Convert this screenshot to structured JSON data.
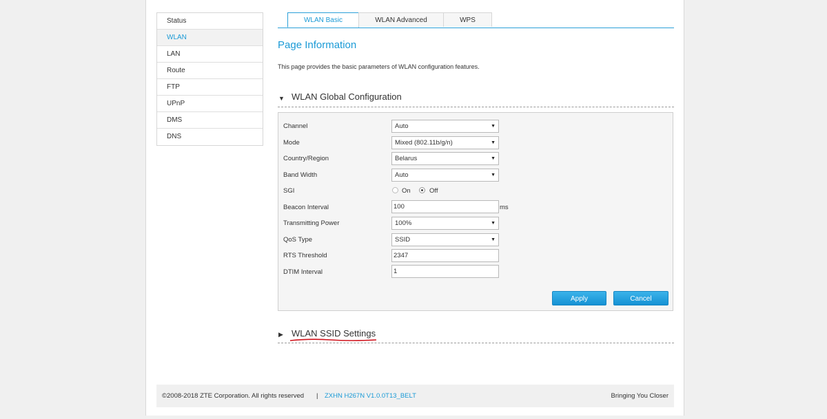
{
  "sidebar": {
    "items": [
      {
        "label": "Status"
      },
      {
        "label": "WLAN"
      },
      {
        "label": "LAN"
      },
      {
        "label": "Route"
      },
      {
        "label": "FTP"
      },
      {
        "label": "UPnP"
      },
      {
        "label": "DMS"
      },
      {
        "label": "DNS"
      }
    ],
    "active": "WLAN"
  },
  "tabs": [
    {
      "label": "WLAN Basic"
    },
    {
      "label": "WLAN Advanced"
    },
    {
      "label": "WPS"
    }
  ],
  "active_tab": "WLAN Basic",
  "page": {
    "title": "Page Information",
    "description": "This page provides the basic parameters of WLAN configuration features."
  },
  "global_config": {
    "title": "WLAN Global Configuration",
    "expand_icon": "triangle-down-icon",
    "channel": {
      "label": "Channel",
      "value": "Auto"
    },
    "mode": {
      "label": "Mode",
      "value": "Mixed (802.11b/g/n)"
    },
    "country": {
      "label": "Country/Region",
      "value": "Belarus"
    },
    "bandwidth": {
      "label": "Band Width",
      "value": "Auto"
    },
    "sgi": {
      "label": "SGI",
      "on_label": "On",
      "off_label": "Off",
      "selected": "Off"
    },
    "beacon": {
      "label": "Beacon Interval",
      "value": "100",
      "unit": "ms"
    },
    "tx_power": {
      "label": "Transmitting Power",
      "value": "100%"
    },
    "qos": {
      "label": "QoS Type",
      "value": "SSID"
    },
    "rts": {
      "label": "RTS Threshold",
      "value": "2347"
    },
    "dtim": {
      "label": "DTIM Interval",
      "value": "1"
    },
    "apply_label": "Apply",
    "cancel_label": "Cancel"
  },
  "ssid_settings": {
    "title": "WLAN SSID Settings",
    "expand_icon": "triangle-right-icon"
  },
  "footer": {
    "copyright": "©2008-2018 ZTE Corporation. All rights reserved",
    "separator": "|",
    "model": "ZXHN H267N V1.0.0T13_BELT",
    "slogan": "Bringing You Closer"
  },
  "colors": {
    "accent": "#1a9ad6",
    "button": "#1592d4",
    "annotation": "#d0121b"
  }
}
